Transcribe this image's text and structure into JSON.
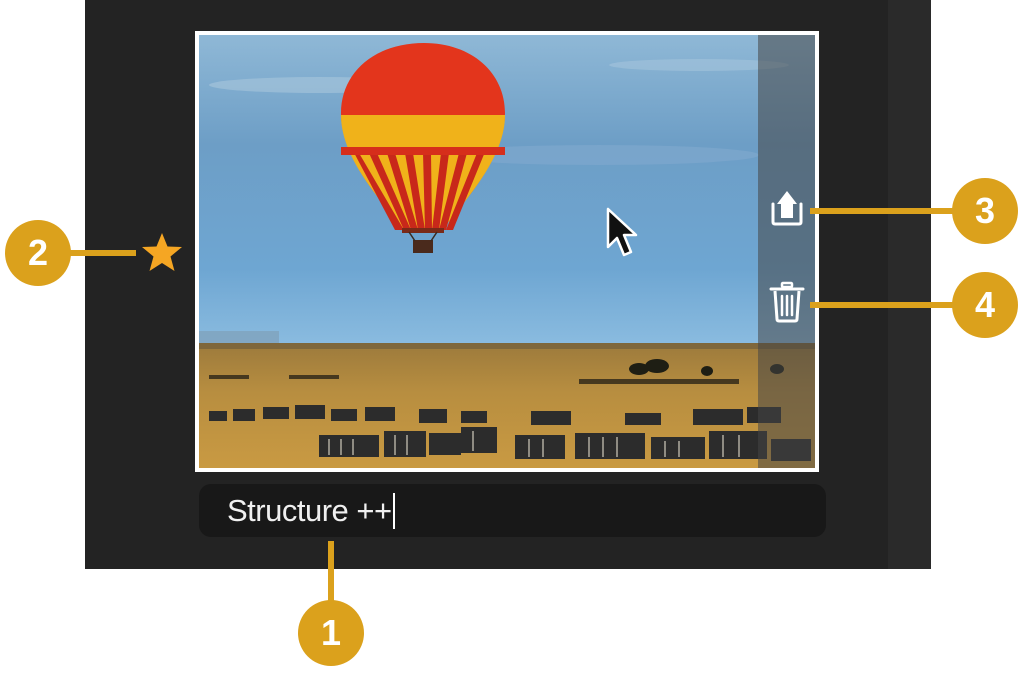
{
  "caption": {
    "text": "Structure ++"
  },
  "flag": {
    "icon": "star-icon",
    "color": "#f5a623"
  },
  "actions": [
    {
      "name": "share",
      "icon": "share-upload-icon"
    },
    {
      "name": "delete",
      "icon": "trash-icon"
    }
  ],
  "callouts": [
    "1",
    "2",
    "3",
    "4"
  ],
  "colors": {
    "callout": "#dba11c",
    "panel": "#232323",
    "caption_bg": "#181818"
  }
}
